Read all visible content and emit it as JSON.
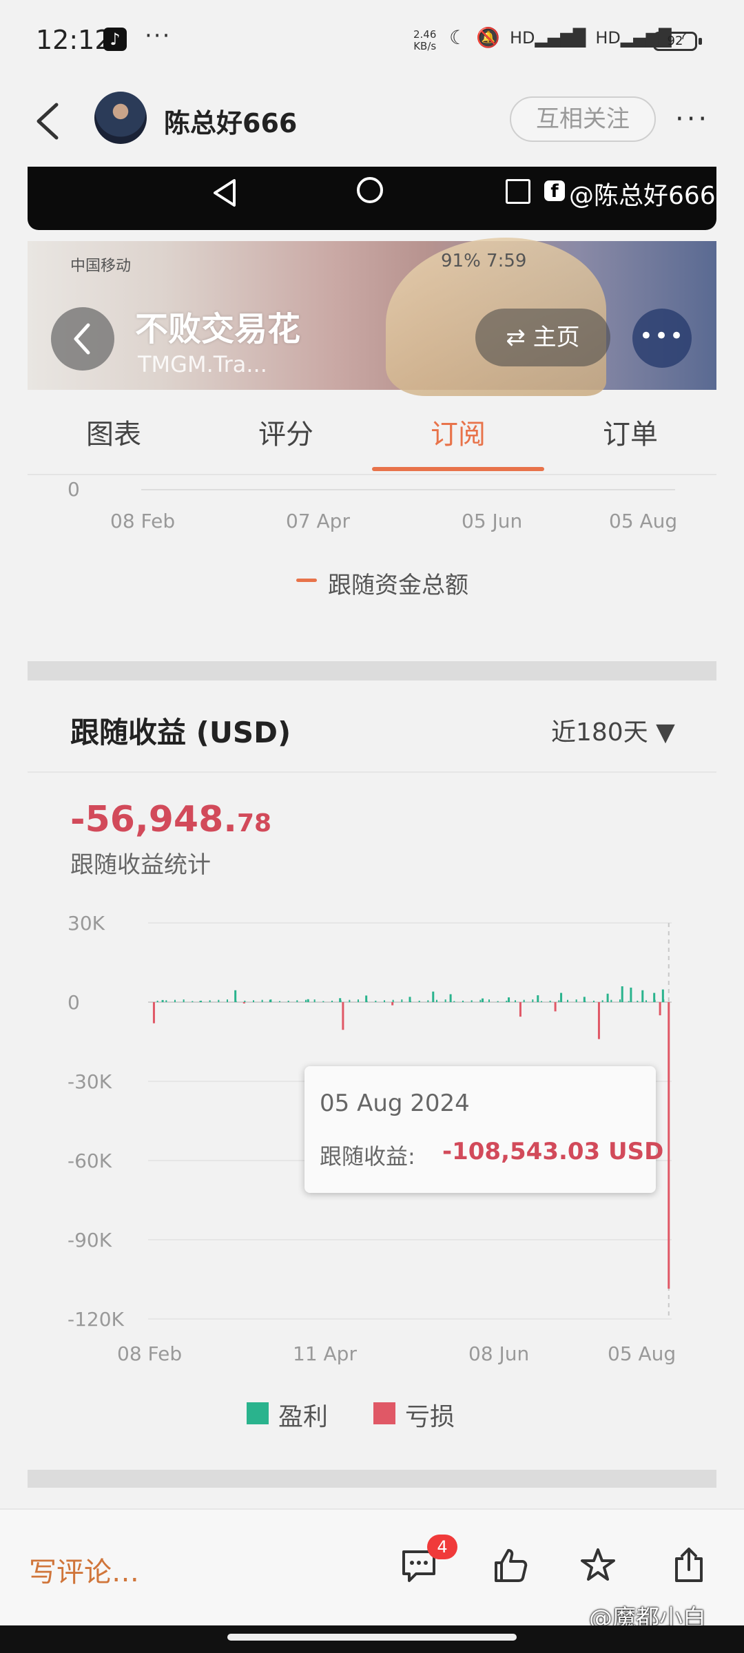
{
  "status_bar": {
    "time": "12:12",
    "dots": "···",
    "net_speed_value": "2.46",
    "net_speed_unit": "KB/s",
    "battery": "92"
  },
  "header": {
    "profile_name": "陈总好666",
    "follow_button": "互相关注",
    "more": "···"
  },
  "nav_strip": {
    "watermark": "@陈总好666"
  },
  "embedded_header": {
    "carrier": "中国移动",
    "status_right": "91%   7:59",
    "title": "不败交易花",
    "subtitle": "TMGM.Tra...",
    "home_button": "⇄ 主页",
    "more": "•••"
  },
  "tabs": [
    {
      "label": "图表",
      "active": false
    },
    {
      "label": "评分",
      "active": false
    },
    {
      "label": "订阅",
      "active": true
    },
    {
      "label": "订单",
      "active": false
    }
  ],
  "upper_chart": {
    "y_tick": "0",
    "x_ticks": [
      "08 Feb",
      "07 Apr",
      "05 Jun",
      "05 Aug"
    ],
    "legend": "跟随资金总额",
    "legend_color": "#e8734a"
  },
  "section": {
    "title": "跟随收益 (USD)",
    "period_select": "近180天 ▼",
    "profit_main": "-56,948.",
    "profit_decimal": "78",
    "profit_caption": "跟随收益统计"
  },
  "chart_data": {
    "type": "bar",
    "title": "跟随收益 (USD)",
    "y_ticks": [
      "30K",
      "0",
      "-30K",
      "-60K",
      "-90K",
      "-120K"
    ],
    "y_tick_values": [
      30000,
      0,
      -30000,
      -60000,
      -90000,
      -120000
    ],
    "ylim": [
      -120000,
      30000
    ],
    "x_ticks": [
      "08 Feb",
      "11 Apr",
      "08 Jun",
      "05 Aug"
    ],
    "grid": true,
    "legend_position": "bottom",
    "series": [
      {
        "name": "盈利",
        "color": "#2ab38d",
        "values": [
          {
            "day": 5,
            "value": 800
          },
          {
            "day": 18,
            "value": 500
          },
          {
            "day": 30,
            "value": 4500
          },
          {
            "day": 42,
            "value": 900
          },
          {
            "day": 55,
            "value": 1100
          },
          {
            "day": 66,
            "value": 1500
          },
          {
            "day": 75,
            "value": 2500
          },
          {
            "day": 90,
            "value": 2000
          },
          {
            "day": 98,
            "value": 4000
          },
          {
            "day": 104,
            "value": 3000
          },
          {
            "day": 115,
            "value": 1400
          },
          {
            "day": 124,
            "value": 1800
          },
          {
            "day": 134,
            "value": 2600
          },
          {
            "day": 142,
            "value": 3500
          },
          {
            "day": 150,
            "value": 2000
          },
          {
            "day": 158,
            "value": 3200
          },
          {
            "day": 163,
            "value": 6000
          },
          {
            "day": 166,
            "value": 5500
          },
          {
            "day": 170,
            "value": 4500
          },
          {
            "day": 174,
            "value": 3500
          },
          {
            "day": 177,
            "value": 4800
          }
        ]
      },
      {
        "name": "亏损",
        "color": "#e05866",
        "values": [
          {
            "day": 2,
            "value": -8000
          },
          {
            "day": 33,
            "value": -500
          },
          {
            "day": 67,
            "value": -10500
          },
          {
            "day": 84,
            "value": -1200
          },
          {
            "day": 128,
            "value": -5500
          },
          {
            "day": 140,
            "value": -3500
          },
          {
            "day": 155,
            "value": -14000
          },
          {
            "day": 176,
            "value": -5000
          },
          {
            "day": 179,
            "value": -108543.03
          }
        ]
      }
    ]
  },
  "tooltip": {
    "date": "05 Aug 2024",
    "label": "跟随收益:",
    "value": "-108,543.03 USD"
  },
  "legend": {
    "profit": "盈利",
    "loss": "亏损"
  },
  "bottom_bar": {
    "comment_placeholder": "写评论…",
    "comments_badge": "4",
    "watermark": "@魔都小白"
  }
}
